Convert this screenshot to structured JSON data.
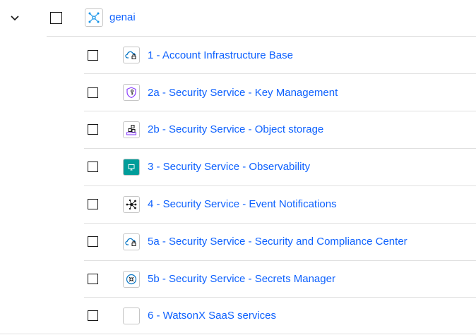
{
  "group": {
    "name": "genai",
    "icon": "deployable-architecture-icon",
    "accent": "#0f62fe"
  },
  "rows": [
    {
      "label": "1 - Account Infrastructure Base",
      "icon": "cloud-lock-icon"
    },
    {
      "label": "2a - Security Service - Key Management",
      "icon": "shield-key-icon"
    },
    {
      "label": "2b - Security Service - Object storage",
      "icon": "object-storage-icon"
    },
    {
      "label": "3 - Security Service - Observability",
      "icon": "observability-icon"
    },
    {
      "label": "4 - Security Service - Event Notifications",
      "icon": "event-notifications-icon"
    },
    {
      "label": "5a - Security Service - Security and Compliance Center",
      "icon": "cloud-lock-icon"
    },
    {
      "label": "5b - Security Service - Secrets Manager",
      "icon": "secrets-manager-icon"
    },
    {
      "label": "6 - WatsonX SaaS services",
      "icon": "blank-icon"
    }
  ]
}
